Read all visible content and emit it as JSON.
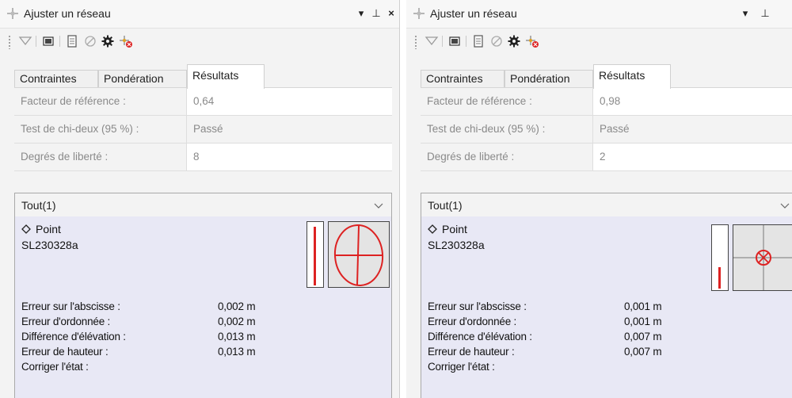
{
  "panels": [
    {
      "title": "Ajuster un réseau",
      "window_buttons": {
        "dropdown": "▾",
        "pin": "⊥",
        "close": "×"
      },
      "tabs": [
        "Contraintes",
        "Pondération",
        "Résultats"
      ],
      "active_tab": 2,
      "properties": [
        {
          "label": "Facteur de référence :",
          "value": "0,64"
        },
        {
          "label": "Test de chi-deux (95 %) :",
          "value": "Passé"
        },
        {
          "label": "Degrés de liberté :",
          "value": "8"
        }
      ],
      "filter": "Tout(1)",
      "point": {
        "type": "Point",
        "name": "SL230328a"
      },
      "error_bar_level": 0.9,
      "stats": [
        {
          "label": "Erreur sur l'abscisse :",
          "value": "0,002 m"
        },
        {
          "label": "Erreur d'ordonnée :",
          "value": "0,002 m"
        },
        {
          "label": "Différence d'élévation :",
          "value": "0,013 m"
        },
        {
          "label": "Erreur de hauteur :",
          "value": "0,013 m"
        },
        {
          "label": "Corriger l'état :",
          "value": ""
        }
      ]
    },
    {
      "title": "Ajuster un réseau",
      "window_buttons": {
        "dropdown": "▾",
        "pin": "⊥",
        "close": ""
      },
      "tabs": [
        "Contraintes",
        "Pondération",
        "Résultats"
      ],
      "active_tab": 2,
      "properties": [
        {
          "label": "Facteur de référence :",
          "value": "0,98"
        },
        {
          "label": "Test de chi-deux (95 %) :",
          "value": "Passé"
        },
        {
          "label": "Degrés de liberté :",
          "value": "2"
        }
      ],
      "filter": "Tout(1)",
      "point": {
        "type": "Point",
        "name": "SL230328a"
      },
      "error_bar_level": 0.33,
      "stats": [
        {
          "label": "Erreur sur l'abscisse :",
          "value": "0,001 m"
        },
        {
          "label": "Erreur d'ordonnée :",
          "value": "0,001 m"
        },
        {
          "label": "Différence d'élévation :",
          "value": "0,007 m"
        },
        {
          "label": "Erreur de hauteur :",
          "value": "0,007 m"
        },
        {
          "label": "Corriger l'état :",
          "value": ""
        }
      ]
    }
  ],
  "toolbar_icons": [
    "filter-icon",
    "display-icon",
    "report-icon",
    "cancel-icon",
    "settings-gear-icon",
    "adjust-network-icon"
  ],
  "colors": {
    "accent_red": "#dd2222",
    "detail_bg": "#e8e8f5",
    "label_grey": "#8a8a8a"
  }
}
